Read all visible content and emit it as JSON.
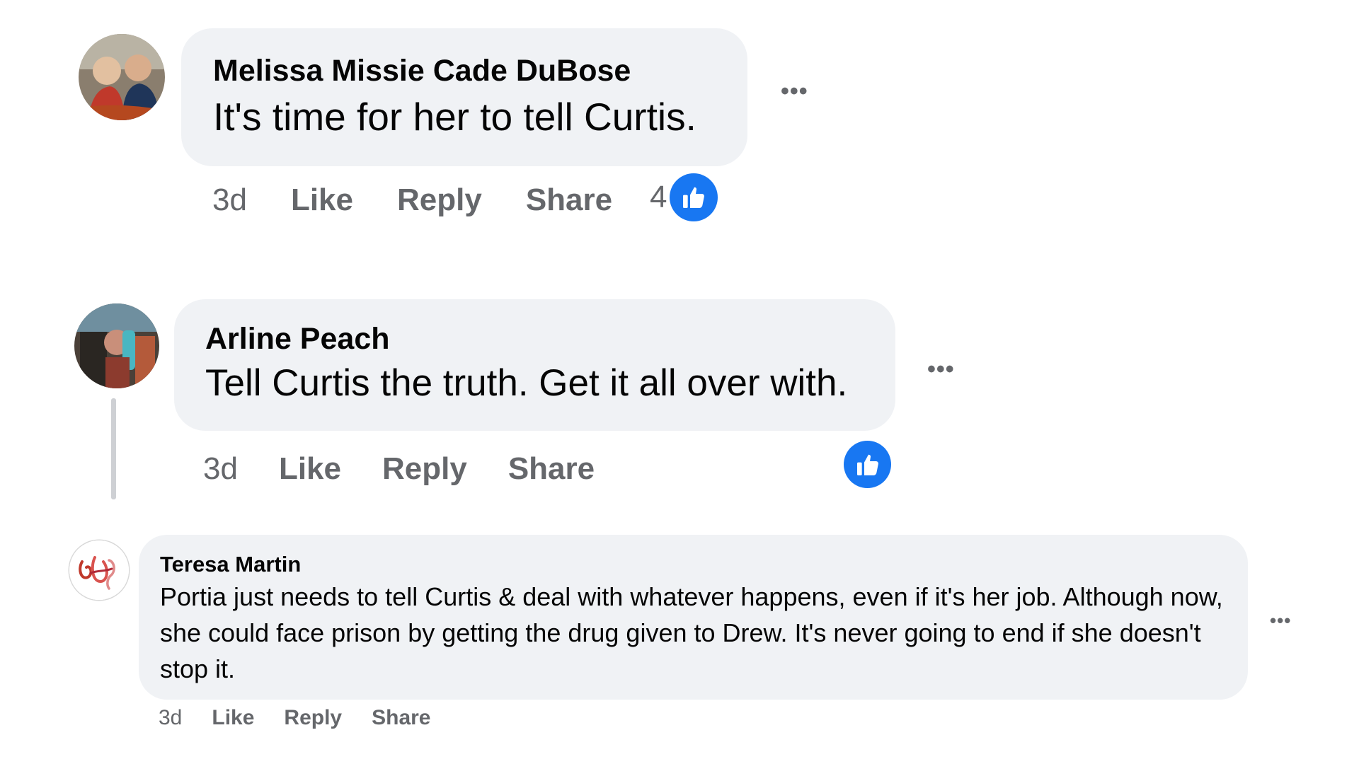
{
  "comments": [
    {
      "author": "Melissa Missie Cade DuBose",
      "text": "It's time for her to tell Curtis.",
      "time": "3d",
      "like_label": "Like",
      "reply_label": "Reply",
      "share_label": "Share",
      "reaction_count": "4",
      "reaction_icon": "like-thumbs-up-icon",
      "more_icon": "more-options-icon"
    },
    {
      "author": "Arline Peach",
      "text": "Tell Curtis the truth. Get it all over with.",
      "time": "3d",
      "like_label": "Like",
      "reply_label": "Reply",
      "share_label": "Share",
      "reaction_icon": "like-thumbs-up-icon",
      "more_icon": "more-options-icon"
    },
    {
      "author": "Teresa Martin",
      "text": "Portia just needs to tell Curtis & deal with whatever happens, even if it's her job. Although now, she could face prison by getting the drug given to Drew. It's never going to end if she doesn't stop it.",
      "time": "3d",
      "like_label": "Like",
      "reply_label": "Reply",
      "share_label": "Share",
      "more_icon": "more-options-icon"
    }
  ],
  "colors": {
    "bubble_bg": "#f0f2f5",
    "secondary_text": "#65676b",
    "like_blue": "#1877f2",
    "thread_line": "#ced0d4"
  }
}
